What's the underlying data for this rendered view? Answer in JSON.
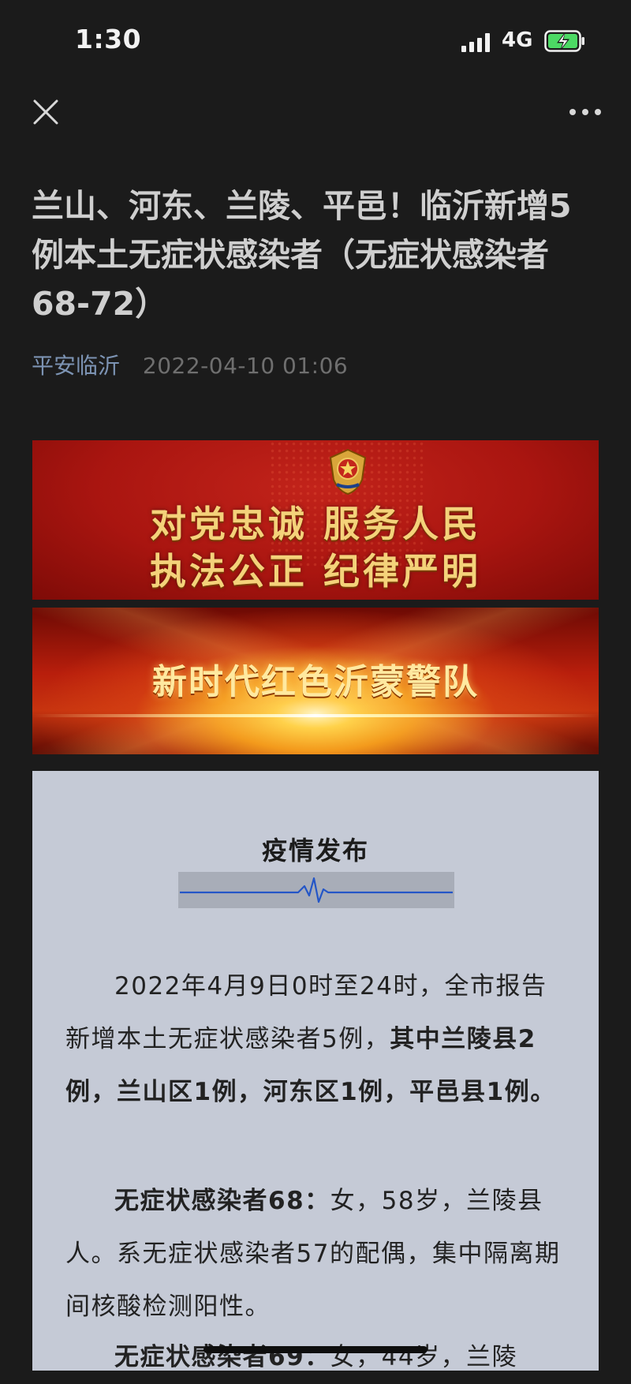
{
  "status_bar": {
    "time": "1:30",
    "network": "4G"
  },
  "article": {
    "title": "兰山、河东、兰陵、平邑！临沂新增5例本土无症状感染者（无症状感染者68-72）",
    "account": "平安临沂",
    "date": "2022-04-10 01:06"
  },
  "banner1": {
    "line1": "对党忠诚 服务人民",
    "line2": "执法公正 纪律严明"
  },
  "banner2": {
    "text": "新时代红色沂蒙警队"
  },
  "card": {
    "heading": "疫情发布",
    "p1_lead": "2022年4月9日0时至24时，全市报告新增本土无症状感染者5例，",
    "p1_bold": "其中兰陵县2例，兰山区1例，河东区1例，平邑县1例。",
    "p2_bold": "无症状感染者68：",
    "p2_text": "女，58岁，兰陵县人。系无症状感染者57的配偶，集中隔离期间核酸检测阳性。",
    "p3_bold": "无症状感染者69：",
    "p3_text": "女，44岁，兰陵"
  },
  "icons": [
    "close-icon",
    "more-icon",
    "signal-icon",
    "battery-charging-icon",
    "police-emblem-icon",
    "pulse-line-icon"
  ],
  "colors": {
    "background": "#1b1b1b",
    "account": "#7c93b3",
    "card": "#c5cad6",
    "banner_red": "#a91510",
    "banner_gold": "#f4d27a"
  }
}
